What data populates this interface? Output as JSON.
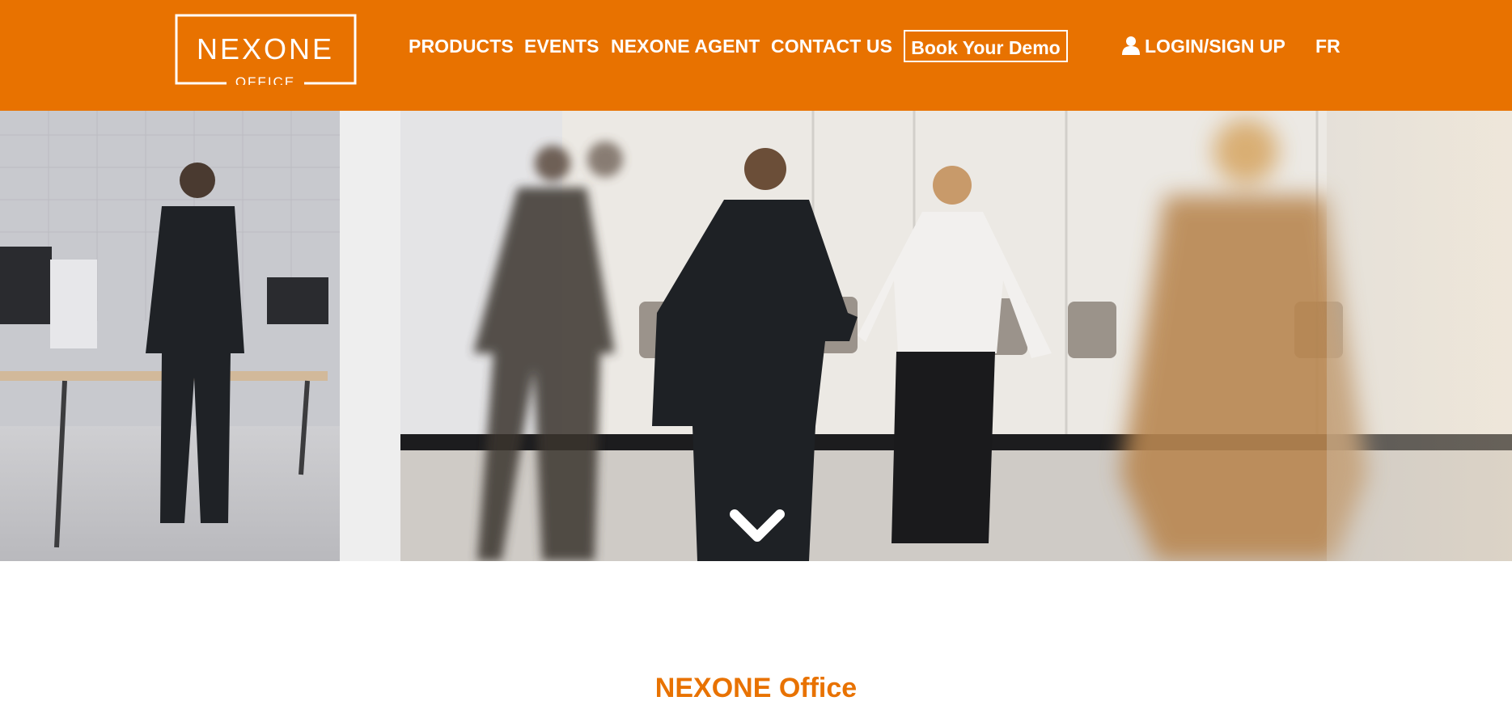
{
  "header": {
    "logo": {
      "wordmark": "NEXONE",
      "subtitle": "OFFICE"
    },
    "nav": [
      {
        "label": "PRODUCTS"
      },
      {
        "label": "EVENTS"
      },
      {
        "label": "NEXONE AGENT"
      },
      {
        "label": "CONTACT US"
      }
    ],
    "demo_button": "Book Your Demo",
    "login_label": "LOGIN/SIGN UP",
    "language_label": "FR",
    "icons": [
      "user-icon"
    ]
  },
  "hero": {
    "icons": [
      "chevron-down-icon"
    ]
  },
  "main": {
    "title": "NEXONE Office"
  },
  "colors": {
    "brand": "#e87200",
    "text_on_brand": "#ffffff"
  }
}
